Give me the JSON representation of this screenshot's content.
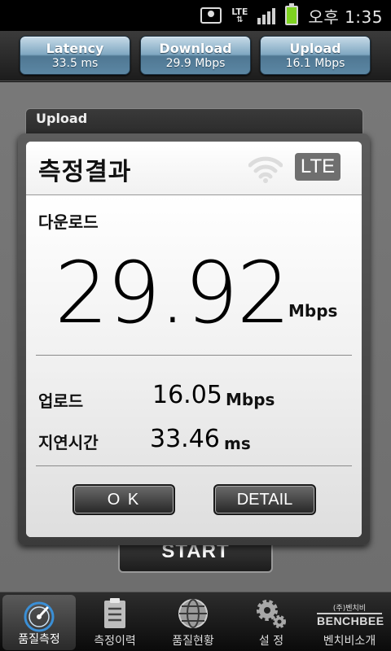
{
  "status_bar": {
    "network": "LTE",
    "time": "오후 1:35"
  },
  "metrics": [
    {
      "title": "Latency",
      "value": "33.5 ms"
    },
    {
      "title": "Download",
      "value": "29.9 Mbps"
    },
    {
      "title": "Upload",
      "value": "16.1 Mbps"
    }
  ],
  "background_panel": {
    "label": "Upload",
    "start_label": "START"
  },
  "dialog": {
    "title": "측정결과",
    "network_badge": "LTE",
    "download_label": "다운로드",
    "download_value": "29.92",
    "download_unit": "Mbps",
    "upload_label": "업로드",
    "upload_value": "16.05",
    "upload_unit": "Mbps",
    "latency_label": "지연시간",
    "latency_value": "33.46",
    "latency_unit": "ms",
    "ok_label": "O K",
    "detail_label": "DETAIL"
  },
  "bottom_nav": {
    "items": [
      {
        "label": "품질측정",
        "icon": "speedometer-icon",
        "active": true
      },
      {
        "label": "측정이력",
        "icon": "clipboard-icon"
      },
      {
        "label": "품질현황",
        "icon": "globe-icon"
      },
      {
        "label": "설 정",
        "icon": "gears-icon"
      },
      {
        "label": "벤치비소개",
        "icon": "benchbee-logo",
        "logo_small": "(주)벤치비",
        "logo_big": "BENCHBEE"
      }
    ]
  },
  "colors": {
    "metric_button": "#6f97b3",
    "accent_blue": "#3a8fd6",
    "battery": "#7ed321"
  }
}
